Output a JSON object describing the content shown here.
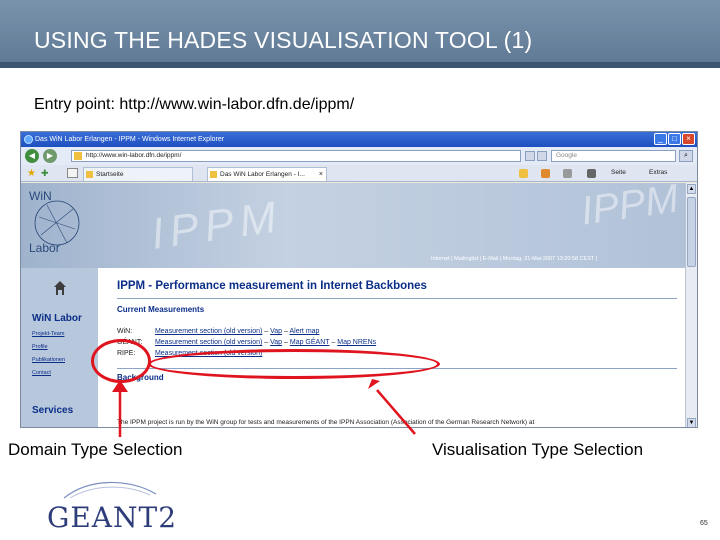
{
  "slide": {
    "title": "USING THE HADES VISUALISATION TOOL (1)",
    "entry_point": "Entry point: http://www.win-labor.dfn.de/ippm/",
    "label_domain": "Domain Type Selection",
    "label_visualisation": "Visualisation Type Selection",
    "page_number": "65",
    "logo_text": "GEANT2",
    "annotation_color": "#e0141e",
    "header_color": "#6b86a2"
  },
  "browser": {
    "window_title": "Das WiN Labor Erlangen - IPPM - Windows Internet Explorer",
    "url": "http://www.win-labor.dfn.de/ippm/",
    "search_placeholder": "Google",
    "tab_favorites_label": "Startseite",
    "tab_active_label": "Das WiN Labor Erlangen - I...",
    "cmd_page": "Seite",
    "cmd_extras": "Extras",
    "info_line": "Internet | Mailinglist | E-Mail | Montag, 21-Mai-2007 13:20:58 CEST |",
    "banner_watermark": "IPPM",
    "banner_watermark_right": "IPPM"
  },
  "sidebar": {
    "logo_top": "WiN",
    "logo_bottom": "Labor",
    "title": "WiN Labor",
    "items": [
      "Projekt-Team",
      "Profile",
      "Publikationen",
      "Contact"
    ],
    "services": "Services"
  },
  "content": {
    "heading": "IPPM - Performance measurement in Internet Backbones",
    "current_measurements": "Current Measurements",
    "rows": [
      {
        "domain": "WiN:",
        "links": [
          "Measurement section (old version)",
          "Vap",
          "Alert map"
        ]
      },
      {
        "domain": "GÉANT:",
        "links": [
          "Measurement section (old version)",
          "Vap",
          "Map GÉANT",
          "Map NRENs"
        ]
      },
      {
        "domain": "RIPE:",
        "links": [
          "Measurement section (old version)"
        ]
      }
    ],
    "background_heading": "Background",
    "background_text": "The IPPM project is run by the WiN group for tests and measurements of the IPPN Association (Association of the German Research Network) at"
  }
}
